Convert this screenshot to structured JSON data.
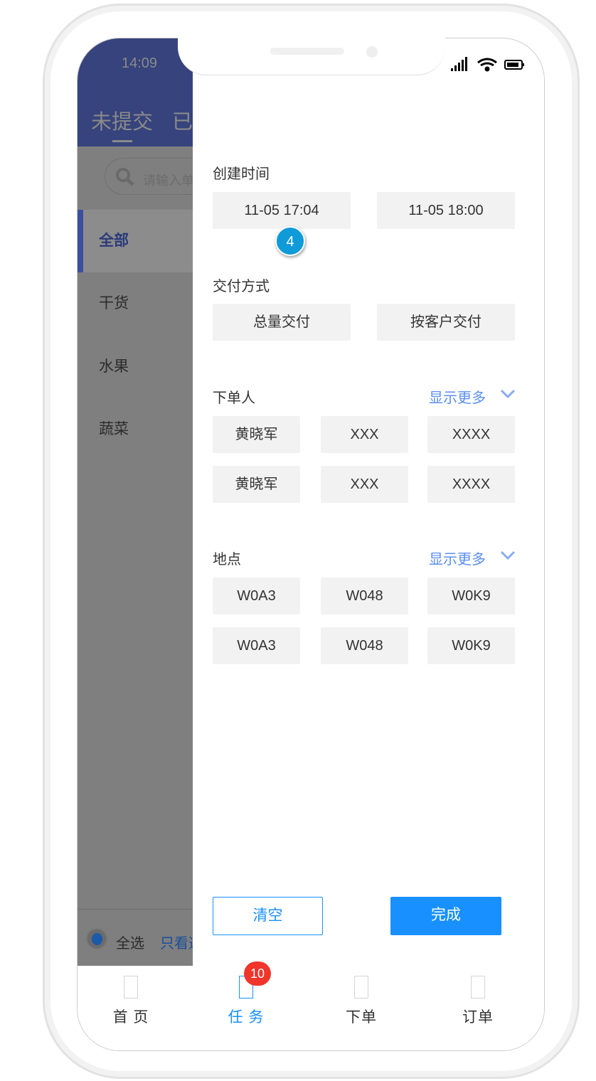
{
  "status_bar": {
    "time": "14:09"
  },
  "background": {
    "tabs": [
      "未提交",
      "已提交"
    ],
    "search_placeholder": "请输入单号",
    "categories": [
      {
        "label": "全部",
        "active": true
      },
      {
        "label": "干货"
      },
      {
        "label": "水果"
      },
      {
        "label": "蔬菜"
      }
    ],
    "select_all": "全选",
    "only_view": "只看选中"
  },
  "filter": {
    "created_time": {
      "label": "创建时间",
      "start": "11-05 17:04",
      "end": "11-05 18:00"
    },
    "delivery": {
      "label": "交付方式",
      "options": [
        "总量交付",
        "按客户交付"
      ]
    },
    "orderer": {
      "label": "下单人",
      "more": "显示更多",
      "options": [
        "黄晓军",
        "XXX",
        "XXXX",
        "黄晓军",
        "XXX",
        "XXXX"
      ]
    },
    "location": {
      "label": "地点",
      "more": "显示更多",
      "options": [
        "W0A3",
        "W048",
        "W0K9",
        "W0A3",
        "W048",
        "W0K9"
      ]
    },
    "clear": "清空",
    "done": "完成"
  },
  "step_marker": "4",
  "tabbar": {
    "items": [
      {
        "label": "首 页"
      },
      {
        "label": "任 务",
        "active": true,
        "badge": "10"
      },
      {
        "label": "下单"
      },
      {
        "label": "订单"
      }
    ]
  },
  "colors": {
    "primary": "#1890ff",
    "header": "#36437c",
    "badge": "#f0352b",
    "link": "#5b8ef0"
  }
}
